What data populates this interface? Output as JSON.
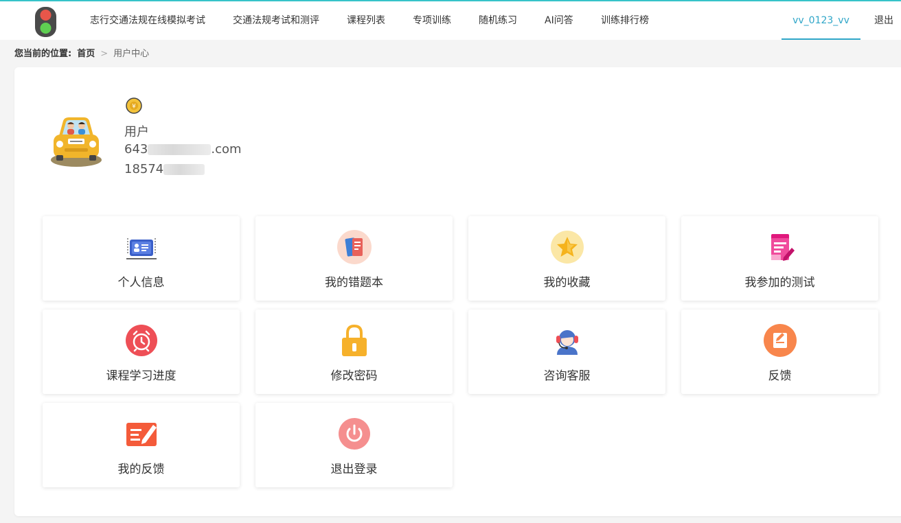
{
  "nav": {
    "items": [
      "志行交通法规在线模拟考试",
      "交通法规考试和测评",
      "课程列表",
      "专项训练",
      "随机练习",
      "AI问答",
      "训练排行榜"
    ],
    "user": "vv_0123_vv",
    "logout": "退出",
    "accent": "#2fa6c8"
  },
  "breadcrumb": {
    "label": "您当前的位置:",
    "home": "首页",
    "separator": ">",
    "current": "用户中心"
  },
  "profile": {
    "role": "用户",
    "email_prefix": "643",
    "email_suffix": ".com",
    "phone_prefix": "18574"
  },
  "tiles": [
    {
      "label": "个人信息",
      "icon": "id-card-icon"
    },
    {
      "label": "我的错题本",
      "icon": "notebook-icon"
    },
    {
      "label": "我的收藏",
      "icon": "star-icon"
    },
    {
      "label": "我参加的测试",
      "icon": "test-document-icon"
    },
    {
      "label": "课程学习进度",
      "icon": "alarm-clock-icon"
    },
    {
      "label": "修改密码",
      "icon": "lock-icon"
    },
    {
      "label": "咨询客服",
      "icon": "headset-agent-icon"
    },
    {
      "label": "反馈",
      "icon": "feedback-note-icon"
    },
    {
      "label": "我的反馈",
      "icon": "edit-feedback-icon"
    },
    {
      "label": "退出登录",
      "icon": "power-icon"
    }
  ]
}
